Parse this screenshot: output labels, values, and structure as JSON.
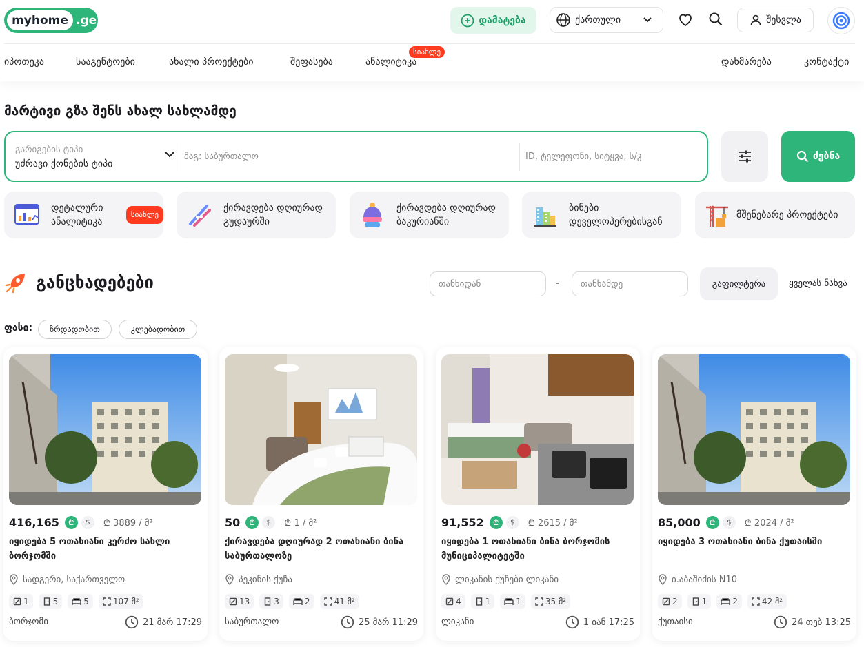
{
  "header": {
    "logo_main": "myhome",
    "logo_suffix": ".ge",
    "add_label": "დამატება",
    "language": "ქართული",
    "login_label": "შესვლა"
  },
  "nav": {
    "items": [
      "იპოთეკა",
      "სააგენტოები",
      "ახალი პროექტები",
      "შეფასება",
      "ანალიტიკა"
    ],
    "new_badge": "სიახლე",
    "right_items": [
      "დახმარება",
      "კონტაქტი"
    ]
  },
  "hero": {
    "title": "მარტივი გზა შენს ახალ სახლამდე",
    "deal_type_label": "გარიგების ტიპი",
    "property_type": "უძრავი ქონების ტიპი",
    "location_placeholder": "მაგ: საბურთალო",
    "id_placeholder": "ID, ტელეფონი, სიტყვა, ს/კ",
    "search_label": "ძებნა"
  },
  "categories": [
    {
      "label": "დეტალური ანალიტიკა",
      "badge": "სიახლე",
      "icon": "analytics-icon"
    },
    {
      "label": "ქირავდება დღიურად გუდაურში",
      "icon": "ski-icon"
    },
    {
      "label": "ქირავდება დღიურად ბაკურიანში",
      "icon": "winter-hat-icon"
    },
    {
      "label": "ბინები დეველოპერებისგან",
      "icon": "buildings-icon"
    },
    {
      "label": "მშენებარე პროექტები",
      "icon": "crane-icon"
    }
  ],
  "listings_section": {
    "title": "განცხადებები",
    "price_from_placeholder": "თანხიდან",
    "separator": "-",
    "price_to_placeholder": "თანხამდე",
    "filter_label": "გაფილტვრა",
    "see_all_label": "ყველას ნახვა",
    "sort_label": "ფასი:",
    "sort_options": [
      "ზრდადობით",
      "კლებადობით"
    ]
  },
  "currency": {
    "lari": "₾",
    "usd": "$"
  },
  "listings": [
    {
      "price": "416,165",
      "sqm_price": "3889 / მ²",
      "title": "იყიდება 5 ოთახიანი კერძო სახლი ბორჯომში",
      "address": "სადგერი, საქართველო",
      "rooms": "1",
      "bedrooms": "5",
      "baths": "5",
      "area": "107 მ²",
      "city": "ბორჯომი",
      "date": "21 მარ 17:29",
      "photo": "street"
    },
    {
      "price": "50",
      "sqm_price": "1 / მ²",
      "title": "ქირავდება დღიურად 2 ოთახიანი ბინა საბურთალოზე",
      "address": "პეკინის ქუჩა",
      "rooms": "13",
      "bedrooms": "3",
      "baths": "2",
      "area": "41 მ²",
      "city": "საბურთალო",
      "date": "25 მარ 11:29",
      "photo": "bedroom"
    },
    {
      "price": "91,552",
      "sqm_price": "2615 / მ²",
      "title": "იყიდება 1 ოთახიანი ბინა ბორჯომის მუნიციპალიტეტში",
      "address": "ლიკანის ქუჩები ლიკანი",
      "rooms": "4",
      "bedrooms": "1",
      "baths": "1",
      "area": "35 მ²",
      "city": "ლიკანი",
      "date": "1 იან 17:25",
      "photo": "studio"
    },
    {
      "price": "85,000",
      "sqm_price": "2024 / მ²",
      "title": "იყიდება 3 ოთახიანი ბინა ქუთაისში",
      "address": "ი.აბაშიძის N10",
      "rooms": "2",
      "bedrooms": "1",
      "baths": "2",
      "area": "42 მ²",
      "city": "ქუთაისი",
      "date": "24 თებ 13:25",
      "photo": "street"
    }
  ],
  "colors": {
    "brand": "#2db57a",
    "badge": "#ff3b1f"
  }
}
